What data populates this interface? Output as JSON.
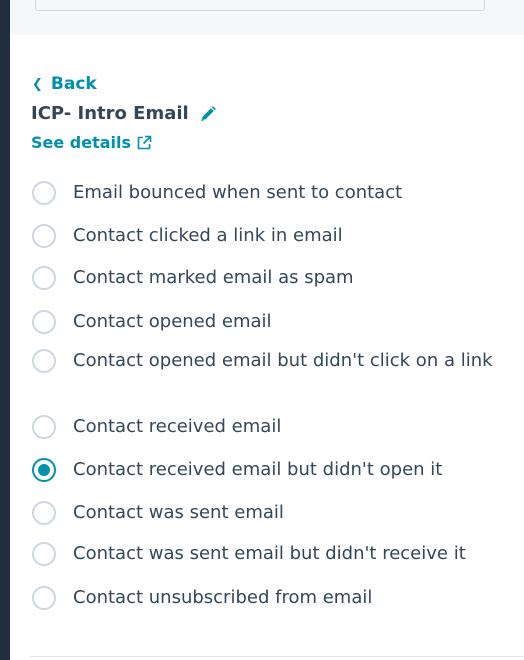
{
  "nav": {
    "back_label": "Back"
  },
  "header": {
    "title": "ICP- Intro Email",
    "see_details_label": "See details"
  },
  "options": [
    {
      "label": "Email bounced when sent to contact",
      "checked": false
    },
    {
      "label": "Contact clicked a link in email",
      "checked": false
    },
    {
      "label": "Contact marked email as spam",
      "checked": false
    },
    {
      "label": "Contact opened email",
      "checked": false
    },
    {
      "label": "Contact opened email but didn't click on a link",
      "checked": false
    },
    {
      "label": "Contact received email",
      "checked": false
    },
    {
      "label": "Contact received email but didn't open it",
      "checked": true
    },
    {
      "label": "Contact was sent email",
      "checked": false
    },
    {
      "label": "Contact was sent email but didn't receive it",
      "checked": false
    },
    {
      "label": "Contact unsubscribed from email",
      "checked": false
    }
  ],
  "colors": {
    "accent": "#0091ae",
    "text": "#33475b",
    "radio_border": "#cbd6e2",
    "sidebar": "#1f2d3d"
  },
  "icons": {
    "back": "chevron-left-icon",
    "edit": "pencil-icon",
    "details": "external-link-icon"
  }
}
